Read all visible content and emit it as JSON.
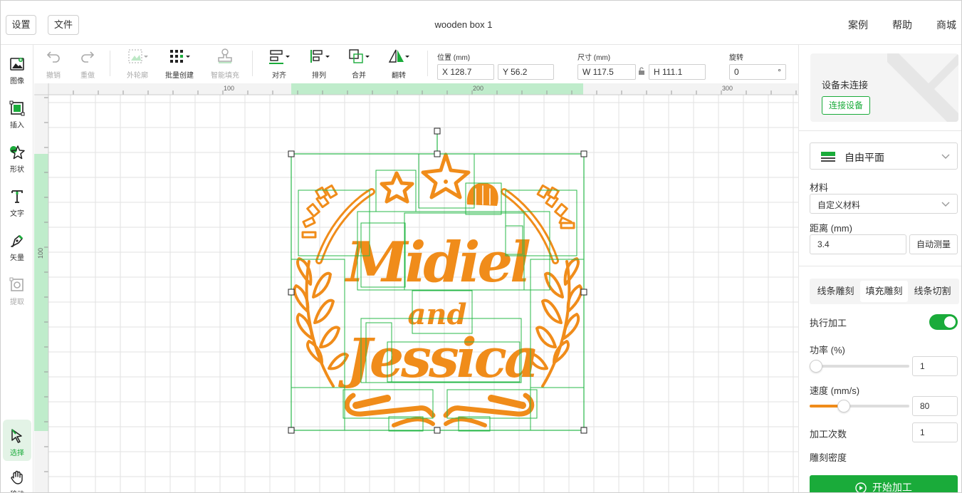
{
  "header": {
    "settings_label": "设置",
    "file_label": "文件",
    "doc_title": "wooden box 1",
    "links": [
      "案例",
      "帮助",
      "商城"
    ]
  },
  "leftbar": {
    "tools": [
      {
        "label": "图像",
        "icon": "image-icon",
        "active": false,
        "disabled": false
      },
      {
        "label": "插入",
        "icon": "insert-icon",
        "active": false,
        "disabled": false
      },
      {
        "label": "形状",
        "icon": "shape-star-icon",
        "active": false,
        "disabled": false
      },
      {
        "label": "文字",
        "icon": "text-icon",
        "active": false,
        "disabled": false
      },
      {
        "label": "矢量",
        "icon": "pen-vector-icon",
        "active": false,
        "disabled": false
      },
      {
        "label": "提取",
        "icon": "extract-icon",
        "active": false,
        "disabled": true
      },
      {
        "label": "选择",
        "icon": "select-cursor-icon",
        "active": true,
        "disabled": false
      },
      {
        "label": "移动",
        "icon": "hand-move-icon",
        "active": false,
        "disabled": false
      }
    ]
  },
  "toolbar": {
    "undo": "撤销",
    "redo": "重做",
    "outline": "外轮廓",
    "batch_create": "批量创建",
    "smart_fill": "智能填充",
    "align": "对齐",
    "arrange": "排列",
    "merge": "合并",
    "flip": "翻转",
    "position_label": "位置 (mm)",
    "x_value": "X 128.7",
    "y_value": "Y 56.2",
    "size_label": "尺寸 (mm)",
    "w_value": "W 117.5",
    "h_value": "H 111.1",
    "rotate_label": "旋转",
    "rotate_value": "0",
    "rotate_unit": "°"
  },
  "canvas": {
    "ruler_top_labels": [
      "100",
      "200",
      "300"
    ],
    "ruler_left_labels": [
      "100"
    ]
  },
  "panel": {
    "device_status": "设备未连接",
    "connect_button": "连接设备",
    "work_mode": "自由平面",
    "material_label": "材料",
    "material_value": "自定义材料",
    "distance_label": "距离 (mm)",
    "distance_value": "3.4",
    "auto_measure": "自动测量",
    "tabs": [
      "线条雕刻",
      "填充雕刻",
      "线条切割"
    ],
    "active_tab": 1,
    "execute_label": "执行加工",
    "execute_on": true,
    "power_label": "功率 (%)",
    "power_value": "1",
    "speed_label": "速度 (mm/s)",
    "speed_value": "80",
    "passes_label": "加工次数",
    "passes_value": "1",
    "density_label": "雕刻密度",
    "start_button": "开始加工"
  },
  "colors": {
    "accent": "#1aab3a",
    "design": "#f08c1a",
    "selection": "#28b84a",
    "ruler_highlight": "#bfeccb"
  }
}
